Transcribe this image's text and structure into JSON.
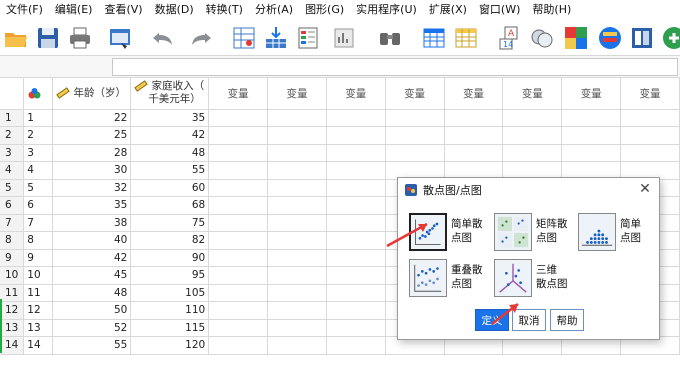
{
  "menu": [
    "文件(F)",
    "编辑(E)",
    "查看(V)",
    "数据(D)",
    "转换(T)",
    "分析(A)",
    "图形(G)",
    "实用程序(U)",
    "扩展(X)",
    "窗口(W)",
    "帮助(H)"
  ],
  "toolbar_icons": [
    "open-folder-icon",
    "save-icon",
    "print-icon",
    "dialog-recall-icon",
    "undo-icon",
    "redo-icon",
    "goto-case-icon",
    "goto-variable-icon",
    "variables-icon",
    "run-descriptive-icon",
    "find-icon",
    "insert-cases-icon",
    "insert-variable-icon",
    "split-file-icon",
    "weight-cases-icon",
    "select-cases-icon",
    "value-labels-icon",
    "use-variable-sets-icon",
    "show-all-variables-icon",
    "spell-check-icon"
  ],
  "grid": {
    "columns": [
      {
        "name": "",
        "type": "nominal"
      },
      {
        "name": "年龄（岁）",
        "type": "scale"
      },
      {
        "name_line1": "家庭收入（",
        "name_line2": "千美元年）",
        "type": "scale"
      },
      {
        "name": "变量"
      },
      {
        "name": "变量"
      },
      {
        "name": "变量"
      },
      {
        "name": "变量"
      },
      {
        "name": "变量"
      },
      {
        "name": "变量"
      },
      {
        "name": "变量"
      },
      {
        "name": "变量"
      }
    ],
    "rows": [
      {
        "n": "1",
        "id": "1",
        "age": "22",
        "income": "35"
      },
      {
        "n": "2",
        "id": "2",
        "age": "25",
        "income": "42"
      },
      {
        "n": "3",
        "id": "3",
        "age": "28",
        "income": "48"
      },
      {
        "n": "4",
        "id": "4",
        "age": "30",
        "income": "55"
      },
      {
        "n": "5",
        "id": "5",
        "age": "32",
        "income": "60"
      },
      {
        "n": "6",
        "id": "6",
        "age": "35",
        "income": "68"
      },
      {
        "n": "7",
        "id": "7",
        "age": "38",
        "income": "75"
      },
      {
        "n": "8",
        "id": "8",
        "age": "40",
        "income": "82"
      },
      {
        "n": "9",
        "id": "9",
        "age": "42",
        "income": "90"
      },
      {
        "n": "10",
        "id": "10",
        "age": "45",
        "income": "95"
      },
      {
        "n": "11",
        "id": "11",
        "age": "48",
        "income": "105"
      },
      {
        "n": "12",
        "id": "12",
        "age": "50",
        "income": "110"
      },
      {
        "n": "13",
        "id": "13",
        "age": "52",
        "income": "115"
      },
      {
        "n": "14",
        "id": "14",
        "age": "55",
        "income": "120"
      }
    ]
  },
  "dialog": {
    "title": "散点图/点图",
    "options": [
      {
        "line1": "简单散",
        "line2": "点图",
        "selected": true
      },
      {
        "line1": "矩阵散",
        "line2": "点图"
      },
      {
        "line1": "简单",
        "line2": "点图"
      },
      {
        "line1": "重叠散",
        "line2": "点图"
      },
      {
        "line1": "三维",
        "line2": "散点图"
      }
    ],
    "buttons": {
      "define": "定义",
      "cancel": "取消",
      "help": "帮助"
    }
  },
  "colors": {
    "accent": "#1a73e8",
    "annotation_arrow": "#e53935",
    "grid_line": "#d9d9d9"
  }
}
